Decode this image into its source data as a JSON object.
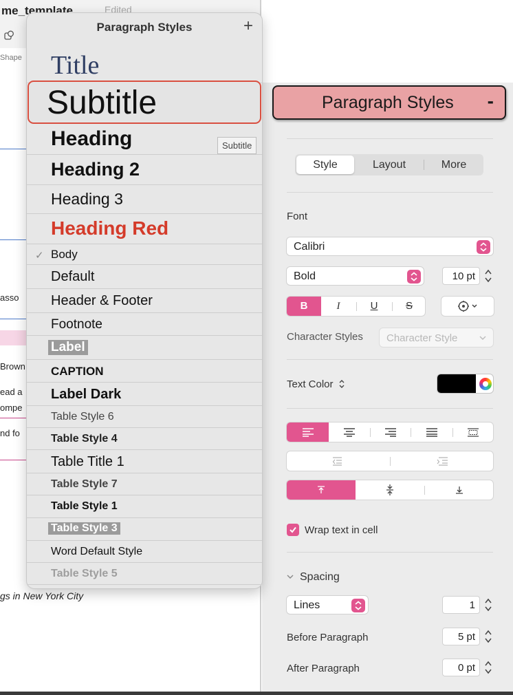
{
  "document": {
    "title": "me_template",
    "edited": "Edited",
    "shape_label": "Shape",
    "snippets": [
      "asso",
      "Brown",
      "ead a",
      "ompe",
      "nd fo"
    ],
    "italic_line": "gs in New York City"
  },
  "styles_popup": {
    "title": "Paragraph Styles",
    "add_label": "+",
    "tooltip": "Subtitle",
    "selected": "Subtitle",
    "items": [
      {
        "label": "Title"
      },
      {
        "label": "Subtitle"
      },
      {
        "label": "Heading"
      },
      {
        "label": "Heading 2"
      },
      {
        "label": "Heading 3"
      },
      {
        "label": "Heading Red"
      },
      {
        "label": "Body",
        "checked": true,
        "check": "✓"
      },
      {
        "label": "Default"
      },
      {
        "label": "Header & Footer"
      },
      {
        "label": "Footnote"
      },
      {
        "label": "Label"
      },
      {
        "label": "CAPTION"
      },
      {
        "label": "Label Dark"
      },
      {
        "label": "Table Style 6"
      },
      {
        "label": "Table Style 4"
      },
      {
        "label": "Table Title 1"
      },
      {
        "label": "Table Style 7"
      },
      {
        "label": "Table Style 1"
      },
      {
        "label": "Table Style 3"
      },
      {
        "label": "Word Default Style"
      },
      {
        "label": "Table Style 5"
      }
    ]
  },
  "inspector": {
    "callout": {
      "label": "Paragraph Styles",
      "collapse": "-"
    },
    "tabs": [
      {
        "label": "Style",
        "active": true
      },
      {
        "label": "Layout"
      },
      {
        "label": "More"
      }
    ],
    "font_label": "Font",
    "font_family": "Calibri",
    "font_weight": "Bold",
    "font_size": "10 pt",
    "format_buttons": {
      "bold": "B",
      "italic": "I",
      "underline": "U",
      "strike": "S"
    },
    "character_styles_label": "Character Styles",
    "character_styles_placeholder": "Character Style",
    "text_color_label": "Text Color",
    "text_color_value": "#000000",
    "wrap_label": "Wrap text in cell",
    "wrap_checked": true,
    "spacing_label": "Spacing",
    "line_spacing_mode": "Lines",
    "line_spacing_value": "1",
    "before_paragraph_label": "Before Paragraph",
    "before_paragraph_value": "5 pt",
    "after_paragraph_label": "After Paragraph",
    "after_paragraph_value": "0 pt",
    "accent_color": "#e2558f"
  }
}
